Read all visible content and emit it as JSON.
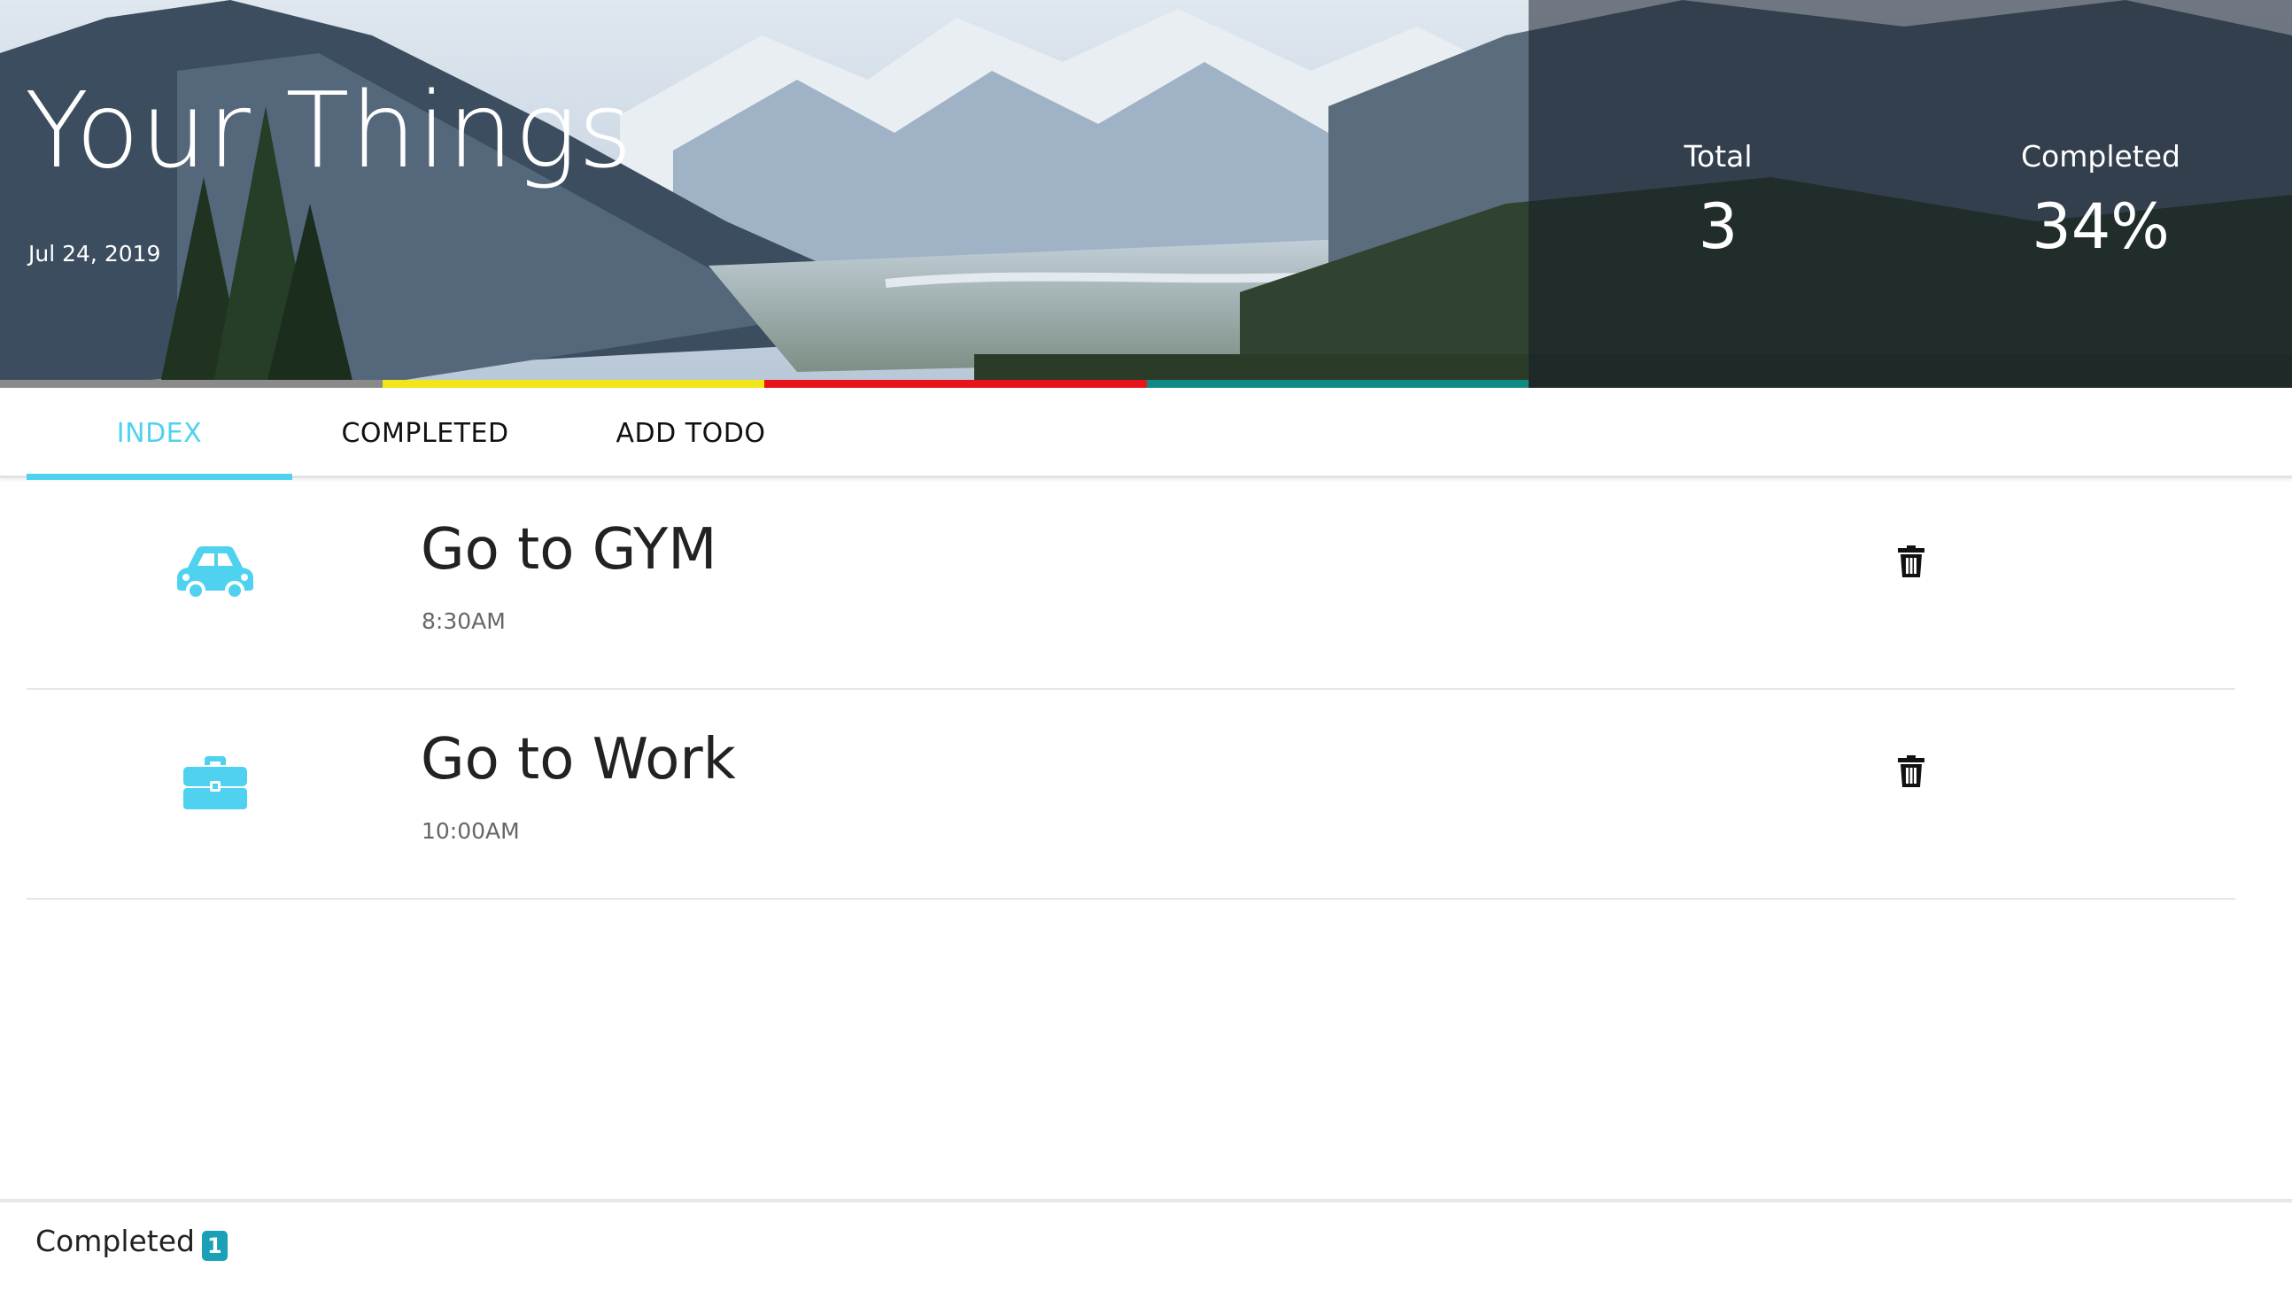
{
  "hero": {
    "title": "Your Things",
    "date": "Jul 24, 2019",
    "stats": {
      "total_label": "Total",
      "total_value": "3",
      "completed_label": "Completed",
      "completed_value": "34%"
    },
    "color_bar": [
      "#8a8a8a",
      "#f2e51a",
      "#e8141c",
      "#0e8a85"
    ]
  },
  "tabs": [
    {
      "label": "INDEX",
      "active": true
    },
    {
      "label": "COMPLETED",
      "active": false
    },
    {
      "label": "ADD TODO",
      "active": false
    }
  ],
  "todos": [
    {
      "icon": "car-icon",
      "title": "Go to GYM",
      "time": "8:30AM"
    },
    {
      "icon": "briefcase-icon",
      "title": "Go to Work",
      "time": "10:00AM"
    }
  ],
  "footer": {
    "label": "Completed",
    "badge": "1"
  },
  "colors": {
    "accent": "#4fd2ef",
    "badge": "#1aa1b8"
  }
}
